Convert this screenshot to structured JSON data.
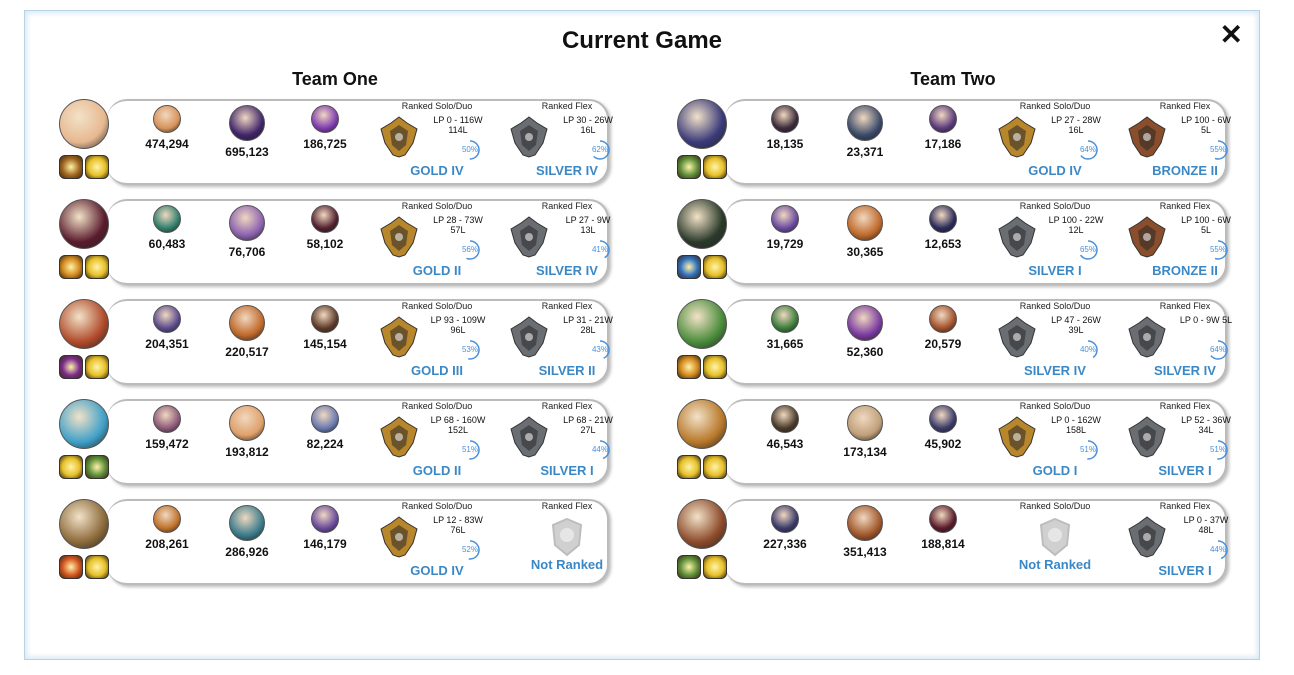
{
  "title": "Current Game",
  "close_label": "✕",
  "labels": {
    "solo": "Ranked Solo/Duo",
    "flex": "Ranked Flex",
    "lp": "LP"
  },
  "colors": {
    "gold": "#b8862b",
    "silver": "#6a6e73",
    "bronze": "#8a4e2c",
    "accent": "#3b88c6"
  },
  "teams": [
    {
      "name": "Team One",
      "players": [
        {
          "champ_color": "#e7b890",
          "spells": [
            "#a0651e",
            "#e7c12a"
          ],
          "mastery": [
            {
              "pts": "474,294",
              "color": "#d8925a"
            },
            {
              "pts": "695,123",
              "color": "#40256a"
            },
            {
              "pts": "186,725",
              "color": "#7f3bb0"
            }
          ],
          "solo": {
            "tier": "GOLD IV",
            "rank": "gold",
            "lp": "LP 0 - 116W",
            "losses": "114L",
            "wr": "50%",
            "wr_frac": 0.5
          },
          "flex": {
            "tier": "SILVER IV",
            "rank": "silver",
            "lp": "LP 30 - 26W",
            "losses": "16L",
            "wr": "62%",
            "wr_frac": 0.62
          }
        },
        {
          "champ_color": "#5a1c2e",
          "spells": [
            "#d4891f",
            "#e7c12a"
          ],
          "mastery": [
            {
              "pts": "60,483",
              "color": "#2f7f6c"
            },
            {
              "pts": "76,706",
              "color": "#8c62b0"
            },
            {
              "pts": "58,102",
              "color": "#52202e"
            }
          ],
          "solo": {
            "tier": "GOLD II",
            "rank": "gold",
            "lp": "LP 28 - 73W",
            "losses": "57L",
            "wr": "56%",
            "wr_frac": 0.56
          },
          "flex": {
            "tier": "SILVER IV",
            "rank": "silver",
            "lp": "LP 27 - 9W",
            "losses": "13L",
            "wr": "41%",
            "wr_frac": 0.41
          }
        },
        {
          "champ_color": "#b04a2a",
          "spells": [
            "#7b2c8c",
            "#e7c12a"
          ],
          "mastery": [
            {
              "pts": "204,351",
              "color": "#5a4a8c"
            },
            {
              "pts": "220,517",
              "color": "#c0692a"
            },
            {
              "pts": "145,154",
              "color": "#5e3a2a"
            }
          ],
          "solo": {
            "tier": "GOLD III",
            "rank": "gold",
            "lp": "LP 93 - 109W",
            "losses": "96L",
            "wr": "53%",
            "wr_frac": 0.53
          },
          "flex": {
            "tier": "SILVER II",
            "rank": "silver",
            "lp": "LP 31 - 21W",
            "losses": "28L",
            "wr": "43%",
            "wr_frac": 0.43
          }
        },
        {
          "champ_color": "#3fa0c8",
          "spells": [
            "#e7c12a",
            "#5e8f3a"
          ],
          "mastery": [
            {
              "pts": "159,472",
              "color": "#8c5a7a"
            },
            {
              "pts": "193,812",
              "color": "#e0a06a"
            },
            {
              "pts": "82,224",
              "color": "#6a7ab0"
            }
          ],
          "solo": {
            "tier": "GOLD II",
            "rank": "gold",
            "lp": "LP 68 - 160W",
            "losses": "152L",
            "wr": "51%",
            "wr_frac": 0.51
          },
          "flex": {
            "tier": "SILVER I",
            "rank": "silver",
            "lp": "LP 68 - 21W",
            "losses": "27L",
            "wr": "44%",
            "wr_frac": 0.44
          }
        },
        {
          "champ_color": "#8c6a3a",
          "spells": [
            "#d4541f",
            "#e7c12a"
          ],
          "mastery": [
            {
              "pts": "208,261",
              "color": "#c0722a"
            },
            {
              "pts": "286,926",
              "color": "#3a7c8c"
            },
            {
              "pts": "146,179",
              "color": "#6a4a9c"
            }
          ],
          "solo": {
            "tier": "GOLD IV",
            "rank": "gold",
            "lp": "LP 12 - 83W",
            "losses": "76L",
            "wr": "52%",
            "wr_frac": 0.52
          },
          "flex": {
            "tier": "Not Ranked",
            "rank": "none",
            "lp": "",
            "losses": "",
            "wr": "",
            "wr_frac": 0
          }
        }
      ]
    },
    {
      "name": "Team Two",
      "players": [
        {
          "champ_color": "#3a3a7a",
          "spells": [
            "#5e8f3a",
            "#e7c12a"
          ],
          "mastery": [
            {
              "pts": "18,135",
              "color": "#3a2a3a"
            },
            {
              "pts": "23,371",
              "color": "#3a4a6a"
            },
            {
              "pts": "17,186",
              "color": "#5a3a7c"
            }
          ],
          "solo": {
            "tier": "GOLD IV",
            "rank": "gold",
            "lp": "LP 27 - 28W",
            "losses": "16L",
            "wr": "64%",
            "wr_frac": 0.64
          },
          "flex": {
            "tier": "BRONZE II",
            "rank": "bronze",
            "lp": "LP 100 - 6W",
            "losses": "5L",
            "wr": "55%",
            "wr_frac": 0.55
          }
        },
        {
          "champ_color": "#2a3a2a",
          "spells": [
            "#2f6fc0",
            "#e7c12a"
          ],
          "mastery": [
            {
              "pts": "19,729",
              "color": "#6a4aa0"
            },
            {
              "pts": "30,365",
              "color": "#c0692a"
            },
            {
              "pts": "12,653",
              "color": "#2a2a5a"
            }
          ],
          "solo": {
            "tier": "SILVER I",
            "rank": "silver",
            "lp": "LP 100 - 22W",
            "losses": "12L",
            "wr": "65%",
            "wr_frac": 0.65
          },
          "flex": {
            "tier": "BRONZE II",
            "rank": "bronze",
            "lp": "LP 100 - 6W",
            "losses": "5L",
            "wr": "55%",
            "wr_frac": 0.55
          }
        },
        {
          "champ_color": "#4a8c3a",
          "spells": [
            "#d4891f",
            "#e7c12a"
          ],
          "mastery": [
            {
              "pts": "31,665",
              "color": "#3a7c3a"
            },
            {
              "pts": "52,360",
              "color": "#7a3aa0"
            },
            {
              "pts": "20,579",
              "color": "#a0502a"
            }
          ],
          "solo": {
            "tier": "SILVER IV",
            "rank": "silver",
            "lp": "LP 47 - 26W",
            "losses": "39L",
            "wr": "40%",
            "wr_frac": 0.4
          },
          "flex": {
            "tier": "SILVER IV",
            "rank": "silver",
            "lp": "LP 0 - 9W 5L",
            "losses": "",
            "wr": "64%",
            "wr_frac": 0.64
          }
        },
        {
          "champ_color": "#b8782a",
          "spells": [
            "#e7c12a",
            "#e7c12a"
          ],
          "mastery": [
            {
              "pts": "46,543",
              "color": "#4a3a2a"
            },
            {
              "pts": "173,134",
              "color": "#c0a07a"
            },
            {
              "pts": "45,902",
              "color": "#3a3a6a"
            }
          ],
          "solo": {
            "tier": "GOLD I",
            "rank": "gold",
            "lp": "LP 0 - 162W",
            "losses": "158L",
            "wr": "51%",
            "wr_frac": 0.51
          },
          "flex": {
            "tier": "SILVER I",
            "rank": "silver",
            "lp": "LP 52 - 36W",
            "losses": "34L",
            "wr": "51%",
            "wr_frac": 0.51
          }
        },
        {
          "champ_color": "#8c4a2a",
          "spells": [
            "#5e8f3a",
            "#e7c12a"
          ],
          "mastery": [
            {
              "pts": "227,336",
              "color": "#3a3a6a"
            },
            {
              "pts": "351,413",
              "color": "#a0562a"
            },
            {
              "pts": "188,814",
              "color": "#5a1a2a"
            }
          ],
          "solo": {
            "tier": "Not Ranked",
            "rank": "none",
            "lp": "",
            "losses": "",
            "wr": "",
            "wr_frac": 0
          },
          "flex": {
            "tier": "SILVER I",
            "rank": "silver",
            "lp": "LP 0 - 37W",
            "losses": "48L",
            "wr": "44%",
            "wr_frac": 0.44
          }
        }
      ]
    }
  ]
}
